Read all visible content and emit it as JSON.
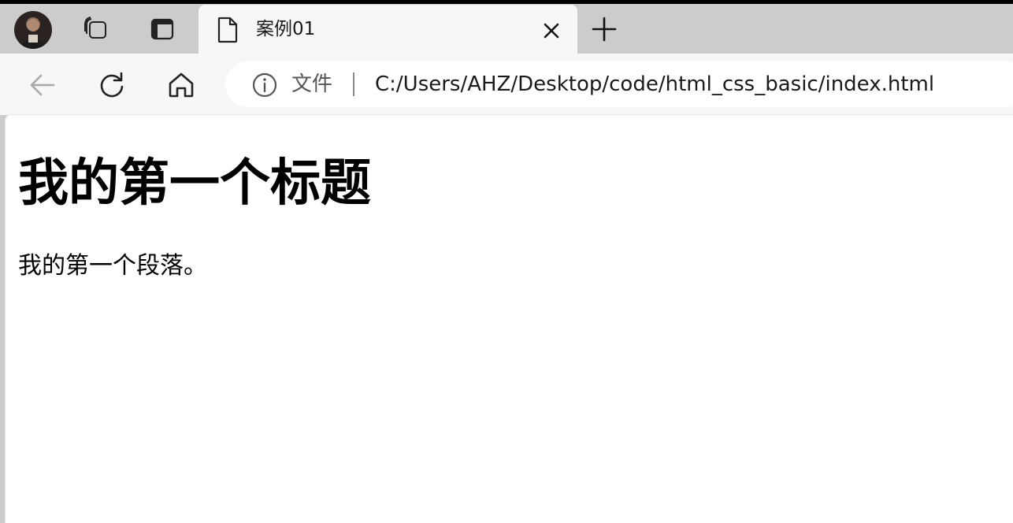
{
  "tabs": {
    "active": {
      "title": "案例01",
      "icon": "document-icon"
    },
    "left_buttons": [
      "profile-avatar",
      "collections-icon",
      "tab-actions-icon"
    ],
    "new_tab_icon": "plus-icon",
    "close_icon": "close-icon"
  },
  "toolbar": {
    "back_icon": "back-arrow-icon",
    "refresh_icon": "refresh-icon",
    "home_icon": "home-icon"
  },
  "address_bar": {
    "info_icon": "info-icon",
    "scheme_label": "文件",
    "url": "C:/Users/AHZ/Desktop/code/html_css_basic/index.html"
  },
  "page": {
    "heading": "我的第一个标题",
    "paragraph": "我的第一个段落。"
  },
  "colors": {
    "tab_strip_bg": "#cccccc",
    "toolbar_bg": "#f7f7f7",
    "content_bg": "#ffffff",
    "text": "#000000"
  }
}
